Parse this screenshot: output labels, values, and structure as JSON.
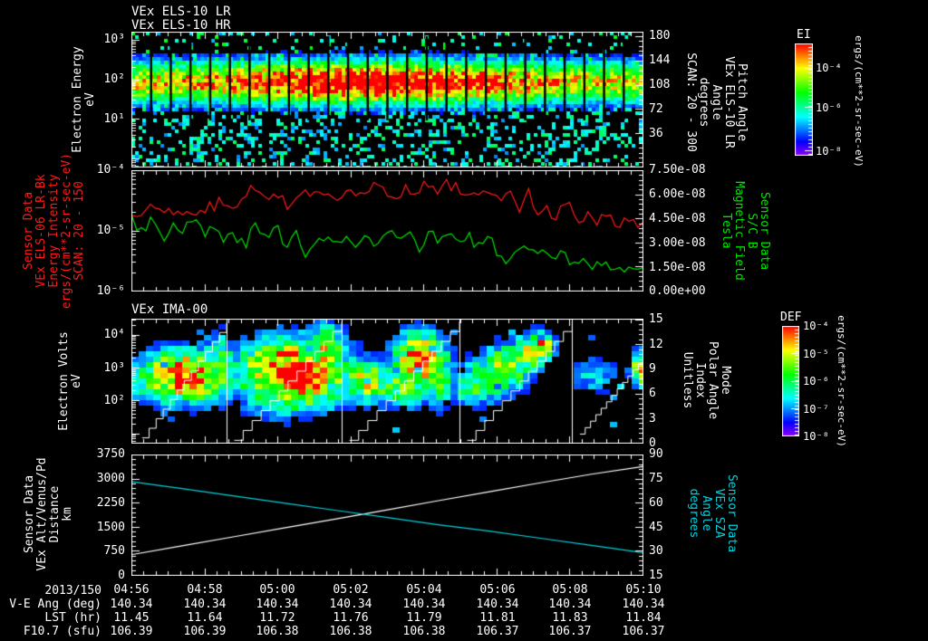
{
  "bottom": {
    "date_label": "2013/150",
    "time_ticks": [
      "04:56",
      "04:58",
      "05:00",
      "05:02",
      "05:04",
      "05:06",
      "05:08",
      "05:10"
    ],
    "rows": [
      {
        "label": "V-E Ang (deg)",
        "values": [
          "140.34",
          "140.34",
          "140.34",
          "140.34",
          "140.34",
          "140.34",
          "140.34",
          "140.34"
        ]
      },
      {
        "label": "LST (hr)",
        "values": [
          "11.45",
          "11.64",
          "11.72",
          "11.76",
          "11.79",
          "11.81",
          "11.83",
          "11.84"
        ]
      },
      {
        "label": "F10.7 (sfu)",
        "values": [
          "106.39",
          "106.39",
          "106.38",
          "106.38",
          "106.38",
          "106.37",
          "106.37",
          "106.37"
        ]
      }
    ]
  },
  "chart_data": [
    {
      "type": "heatmap",
      "name": "els-electron-energy-spectrogram",
      "title": [
        "VEx ELS-10 LR",
        "VEx ELS-10 HR"
      ],
      "ylabel_lines": [
        "Electron Energy",
        "eV"
      ],
      "yticks": [
        "10³",
        "10²",
        "10¹"
      ],
      "y_range_log10_eV": [
        -0.2,
        3.2
      ],
      "x_range": [
        "04:56",
        "05:10"
      ],
      "right_axis": {
        "label_lines": [
          "Pitch Angle",
          "VEx ELS-10 LR",
          "Angle",
          "degrees",
          "SCAN: 20 - 300"
        ],
        "ticks": [
          "180",
          "144",
          "108",
          "72",
          "36"
        ],
        "range": [
          0,
          190
        ]
      },
      "colorbar": {
        "title": "EI",
        "ticks": [
          "10⁻⁴",
          "10⁻⁶",
          "10⁻⁸"
        ],
        "tick_fracs": [
          0.22,
          0.57,
          0.96
        ],
        "unit": "ergs/(cm**2-sr-sec-eV)"
      },
      "render": {
        "seed": 7,
        "cell": 4,
        "segments": 26,
        "band_center_frac": 0.36,
        "band_sigma": 0.11,
        "amp_base": 0.62,
        "amp_peak": 0.38,
        "peak_x": 0.47,
        "peak_w": 0.28,
        "upper_speckle": 0.12,
        "lower_speckle": 0.3
      }
    },
    {
      "type": "line",
      "name": "energy-intensity-and-magnetic-field",
      "left_axis": {
        "label_lines": [
          "Sensor Data",
          "VEx ELS-06 LR-Bk",
          "Energy Intensity",
          "ergs/(cm**2-sr-sec-eV)",
          "SCAN: 20 - 150"
        ],
        "color": "#ff1a1a",
        "ticks": [
          "10⁻⁴",
          "10⁻⁵",
          "10⁻⁶"
        ],
        "range_log10": [
          -6,
          -4
        ]
      },
      "right_axis": {
        "label_lines": [
          "Sensor Data",
          "S/C B",
          "Magnetic Field",
          "Tesla"
        ],
        "color": "#00e400",
        "ticks": [
          "7.50e-08",
          "6.00e-08",
          "4.50e-08",
          "3.00e-08",
          "1.50e-08",
          "0.00e+00"
        ],
        "range_tesla": [
          0,
          7.5e-08
        ]
      },
      "render": {
        "seed": 3,
        "points": 113
      },
      "series": [
        {
          "name": "els_energy_intensity",
          "color": "#ff1a1a",
          "axis": "left",
          "noise": 0.11,
          "trend_log10": [
            [
              0,
              -4.75
            ],
            [
              0.03,
              -4.55
            ],
            [
              0.06,
              -4.75
            ],
            [
              0.09,
              -4.6
            ],
            [
              0.12,
              -4.78
            ],
            [
              0.15,
              -4.62
            ],
            [
              0.18,
              -4.5
            ],
            [
              0.2,
              -4.65
            ],
            [
              0.225,
              -4.35
            ],
            [
              0.24,
              -4.2
            ],
            [
              0.26,
              -4.5
            ],
            [
              0.28,
              -4.35
            ],
            [
              0.3,
              -4.58
            ],
            [
              0.33,
              -4.3
            ],
            [
              0.35,
              -4.5
            ],
            [
              0.37,
              -4.28
            ],
            [
              0.4,
              -4.42
            ],
            [
              0.43,
              -4.25
            ],
            [
              0.45,
              -4.4
            ],
            [
              0.47,
              -4.28
            ],
            [
              0.49,
              -4.35
            ],
            [
              0.52,
              -4.42
            ],
            [
              0.54,
              -4.25
            ],
            [
              0.56,
              -4.35
            ],
            [
              0.58,
              -4.22
            ],
            [
              0.6,
              -4.32
            ],
            [
              0.62,
              -4.18
            ],
            [
              0.64,
              -4.35
            ],
            [
              0.66,
              -4.28
            ],
            [
              0.68,
              -4.45
            ],
            [
              0.7,
              -4.35
            ],
            [
              0.72,
              -4.55
            ],
            [
              0.74,
              -4.4
            ],
            [
              0.76,
              -4.65
            ],
            [
              0.775,
              -4.35
            ],
            [
              0.79,
              -4.7
            ],
            [
              0.81,
              -4.55
            ],
            [
              0.83,
              -4.85
            ],
            [
              0.85,
              -4.45
            ],
            [
              0.87,
              -4.85
            ],
            [
              0.89,
              -4.75
            ],
            [
              0.91,
              -4.9
            ],
            [
              0.93,
              -4.72
            ],
            [
              0.95,
              -4.95
            ],
            [
              0.97,
              -4.8
            ],
            [
              1,
              -4.92
            ]
          ]
        },
        {
          "name": "sc_magnetic_field",
          "color": "#00e400",
          "axis": "left",
          "noise": 0.12,
          "tail_damp": 0.75,
          "trend_log10": [
            [
              0,
              -4.82
            ],
            [
              0.02,
              -4.95
            ],
            [
              0.04,
              -4.8
            ],
            [
              0.06,
              -5.12
            ],
            [
              0.08,
              -4.88
            ],
            [
              0.1,
              -4.95
            ],
            [
              0.12,
              -4.82
            ],
            [
              0.14,
              -5.08
            ],
            [
              0.16,
              -4.9
            ],
            [
              0.18,
              -5.22
            ],
            [
              0.2,
              -5.0
            ],
            [
              0.22,
              -5.3
            ],
            [
              0.24,
              -4.92
            ],
            [
              0.26,
              -5.12
            ],
            [
              0.28,
              -4.88
            ],
            [
              0.3,
              -5.18
            ],
            [
              0.32,
              -5.05
            ],
            [
              0.34,
              -5.5
            ],
            [
              0.36,
              -5.2
            ],
            [
              0.38,
              -5.02
            ],
            [
              0.4,
              -5.28
            ],
            [
              0.42,
              -5.08
            ],
            [
              0.44,
              -5.32
            ],
            [
              0.46,
              -5.12
            ],
            [
              0.48,
              -5.28
            ],
            [
              0.5,
              -5.02
            ],
            [
              0.52,
              -5.22
            ],
            [
              0.54,
              -5.08
            ],
            [
              0.56,
              -5.28
            ],
            [
              0.58,
              -5.02
            ],
            [
              0.6,
              -5.18
            ],
            [
              0.62,
              -4.98
            ],
            [
              0.64,
              -5.22
            ],
            [
              0.66,
              -5.08
            ],
            [
              0.68,
              -5.32
            ],
            [
              0.7,
              -5.12
            ],
            [
              0.72,
              -5.38
            ],
            [
              0.74,
              -5.52
            ],
            [
              0.76,
              -5.32
            ],
            [
              0.78,
              -5.45
            ],
            [
              0.8,
              -5.38
            ],
            [
              0.82,
              -5.52
            ],
            [
              0.84,
              -5.35
            ],
            [
              0.86,
              -5.58
            ],
            [
              0.88,
              -5.45
            ],
            [
              0.9,
              -5.62
            ],
            [
              0.92,
              -5.52
            ],
            [
              0.94,
              -5.62
            ],
            [
              0.96,
              -5.66
            ],
            [
              0.98,
              -5.6
            ],
            [
              1,
              -5.65
            ]
          ]
        }
      ]
    },
    {
      "type": "heatmap",
      "name": "ima-ion-spectrogram",
      "title": "VEx IMA-00",
      "ylabel_lines": [
        "Electron Volts",
        "eV"
      ],
      "yticks": [
        "10⁴",
        "10³",
        "10²"
      ],
      "y_range_log10_eV": [
        0.7,
        4.5
      ],
      "right_axis": {
        "label_lines": [
          "Mode",
          "Polar Angle",
          "Index",
          "Unitless"
        ],
        "ticks": [
          "15",
          "12",
          "9",
          "6",
          "3",
          "0"
        ],
        "range": [
          0,
          15
        ]
      },
      "colorbar": {
        "title": "DEF",
        "ticks": [
          "10⁻⁴",
          "10⁻⁵",
          "10⁻⁶",
          "10⁻⁷",
          "10⁻⁸"
        ],
        "tick_fracs": [
          0,
          0.25,
          0.5,
          0.75,
          1
        ],
        "unit": "ergs/(cm**2-sr-sec-eV)"
      },
      "render": {
        "seed": 11,
        "cellw": 8,
        "cellh": 6,
        "dash_count": 26,
        "separators": [
          0.185,
          0.41,
          0.64,
          0.86
        ],
        "stairs": [
          [
            0.02,
            0.185,
            0.95,
            0.03
          ],
          [
            0.2,
            0.41,
            0.97,
            0.02
          ],
          [
            0.425,
            0.64,
            0.97,
            0.02
          ],
          [
            0.655,
            0.86,
            0.97,
            0.02
          ],
          [
            0.875,
            1.0,
            0.92,
            0.3
          ]
        ],
        "blobs": [
          [
            0.035,
            0.55,
            0.045,
            0.1,
            0.45
          ],
          [
            0.105,
            0.46,
            0.075,
            0.17,
            0.95
          ],
          [
            0.17,
            0.4,
            0.03,
            0.22,
            0.6
          ],
          [
            0.24,
            0.5,
            0.05,
            0.12,
            0.55
          ],
          [
            0.315,
            0.44,
            0.085,
            0.22,
            1.1
          ],
          [
            0.38,
            0.35,
            0.03,
            0.25,
            0.8
          ],
          [
            0.46,
            0.5,
            0.05,
            0.15,
            0.7
          ],
          [
            0.52,
            0.55,
            0.07,
            0.12,
            0.6
          ],
          [
            0.565,
            0.33,
            0.04,
            0.17,
            1.05
          ],
          [
            0.6,
            0.45,
            0.025,
            0.2,
            0.6
          ],
          [
            0.665,
            0.55,
            0.03,
            0.12,
            0.55
          ],
          [
            0.7,
            0.47,
            0.04,
            0.15,
            0.65
          ],
          [
            0.735,
            0.38,
            0.04,
            0.15,
            0.7
          ],
          [
            0.775,
            0.28,
            0.03,
            0.12,
            0.75
          ],
          [
            0.8,
            0.22,
            0.02,
            0.1,
            0.8
          ],
          [
            0.905,
            0.45,
            0.04,
            0.12,
            0.35
          ],
          [
            0.995,
            0.4,
            0.015,
            0.1,
            0.95
          ]
        ]
      }
    },
    {
      "type": "line",
      "name": "orbit-altitude-and-sza",
      "left_axis": {
        "label_lines": [
          "Sensor Data",
          "VEx Alt/Venus/Pd",
          "Distance",
          "km"
        ],
        "ticks": [
          "3750",
          "3000",
          "2250",
          "1500",
          "750",
          "0"
        ],
        "range_km": [
          0,
          3750
        ]
      },
      "right_axis": {
        "label_lines": [
          "Sensor Data",
          "VEx SZA",
          "Angle",
          "degrees"
        ],
        "color": "#00d2e0",
        "ticks": [
          "90",
          "75",
          "60",
          "45",
          "30",
          "15"
        ],
        "range_deg": [
          15,
          90
        ]
      },
      "series": [
        {
          "name": "altitude_km",
          "color": "#ffffff",
          "axis": "left",
          "values": [
            640,
            920,
            1200,
            1480,
            1760,
            2040,
            2330,
            2610,
            2890,
            3160,
            3400
          ]
        },
        {
          "name": "sza_deg",
          "color": "#00d2e0",
          "axis": "right",
          "values": [
            73.5,
            69,
            64.5,
            60,
            55.5,
            51,
            46.5,
            42.5,
            38,
            33.5,
            29
          ]
        }
      ]
    }
  ]
}
